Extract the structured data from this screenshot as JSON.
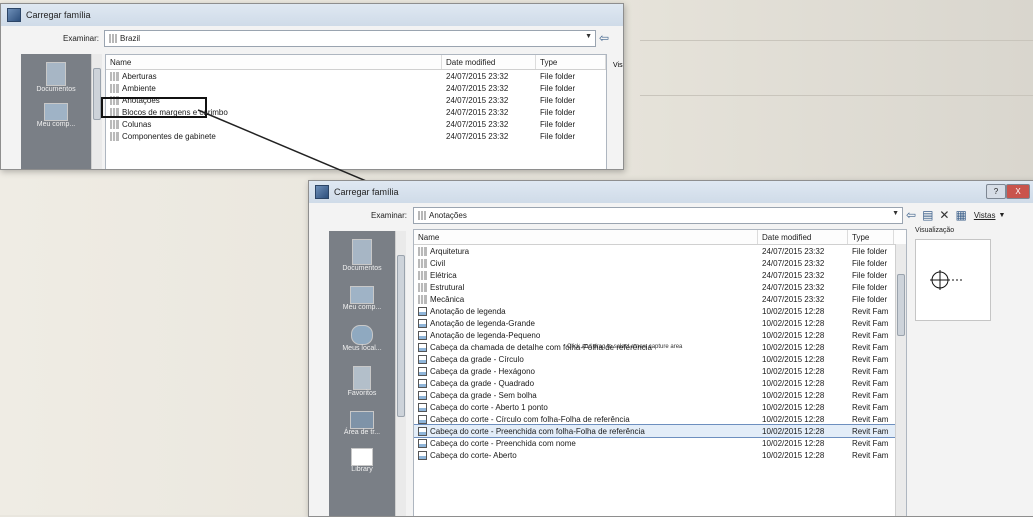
{
  "dialog1": {
    "title": "Carregar família",
    "examinar_label": "Examinar:",
    "path": "Brazil",
    "columns": [
      "Name",
      "Date modified",
      "Type"
    ],
    "rows": [
      {
        "name": "Aberturas",
        "date": "24/07/2015 23:32",
        "type": "File folder"
      },
      {
        "name": "Ambiente",
        "date": "24/07/2015 23:32",
        "type": "File folder"
      },
      {
        "name": "Anotações",
        "date": "24/07/2015 23:32",
        "type": "File folder"
      },
      {
        "name": "Blocos de margens e carimbo",
        "date": "24/07/2015 23:32",
        "type": "File folder"
      },
      {
        "name": "Colunas",
        "date": "24/07/2015 23:32",
        "type": "File folder"
      },
      {
        "name": "Componentes de gabinete",
        "date": "24/07/2015 23:32",
        "type": "File folder"
      }
    ],
    "places": [
      "Documentos",
      "Meu comp..."
    ],
    "toolbar_right": "Vis"
  },
  "dialog2": {
    "title": "Carregar família",
    "examinar_label": "Examinar:",
    "path": "Anotações",
    "columns": [
      "Name",
      "Date modified",
      "Type"
    ],
    "toolbar": {
      "views_label": "Vistas",
      "preview_label": "Visualização"
    },
    "places": [
      "Documentos",
      "Meu comp...",
      "Meus local...",
      "Favoritos",
      "Área de tr...",
      "Library"
    ],
    "rows": [
      {
        "name": "Arquitetura",
        "date": "24/07/2015 23:32",
        "type": "File folder",
        "kind": "folder"
      },
      {
        "name": "Civil",
        "date": "24/07/2015 23:32",
        "type": "File folder",
        "kind": "folder"
      },
      {
        "name": "Elétrica",
        "date": "24/07/2015 23:32",
        "type": "File folder",
        "kind": "folder"
      },
      {
        "name": "Estrutural",
        "date": "24/07/2015 23:32",
        "type": "File folder",
        "kind": "folder"
      },
      {
        "name": "Mecânica",
        "date": "24/07/2015 23:32",
        "type": "File folder",
        "kind": "folder"
      },
      {
        "name": "Anotação de legenda",
        "date": "10/02/2015 12:28",
        "type": "Revit Fam",
        "kind": "rfa"
      },
      {
        "name": "Anotação de legenda-Grande",
        "date": "10/02/2015 12:28",
        "type": "Revit Fam",
        "kind": "rfa"
      },
      {
        "name": "Anotação de legenda-Pequeno",
        "date": "10/02/2015 12:28",
        "type": "Revit Fam",
        "kind": "rfa"
      },
      {
        "name": "Cabeça da chamada de detalhe com folha-Folha de referência",
        "date": "10/02/2015 12:28",
        "type": "Revit Fam",
        "kind": "rfa"
      },
      {
        "name": "Cabeça da grade - Círculo",
        "date": "10/02/2015 12:28",
        "type": "Revit Fam",
        "kind": "rfa"
      },
      {
        "name": "Cabeça da grade - Hexágono",
        "date": "10/02/2015 12:28",
        "type": "Revit Fam",
        "kind": "rfa"
      },
      {
        "name": "Cabeça da grade - Quadrado",
        "date": "10/02/2015 12:28",
        "type": "Revit Fam",
        "kind": "rfa"
      },
      {
        "name": "Cabeça da grade - Sem bolha",
        "date": "10/02/2015 12:28",
        "type": "Revit Fam",
        "kind": "rfa"
      },
      {
        "name": "Cabeça do corte - Aberto 1 ponto",
        "date": "10/02/2015 12:28",
        "type": "Revit Fam",
        "kind": "rfa"
      },
      {
        "name": "Cabeça do corte - Círculo com folha-Folha de referência",
        "date": "10/02/2015 12:28",
        "type": "Revit Fam",
        "kind": "rfa"
      },
      {
        "name": "Cabeça do corte - Preenchida com folha-Folha de referência",
        "date": "10/02/2015 12:28",
        "type": "Revit Fam",
        "kind": "rfa"
      },
      {
        "name": "Cabeça do corte - Preenchida com nome",
        "date": "10/02/2015 12:28",
        "type": "Revit Fam",
        "kind": "rfa"
      },
      {
        "name": "Cabeça do corte- Aberto",
        "date": "10/02/2015 12:28",
        "type": "Revit Fam",
        "kind": "rfa"
      }
    ],
    "selected_index": 15,
    "capture_hint": "Click and drag to select a new capture area"
  },
  "colors": {
    "selection": "#e3edf8",
    "selection_border": "#6d8fbf",
    "places_bg": "#7a7f86"
  }
}
